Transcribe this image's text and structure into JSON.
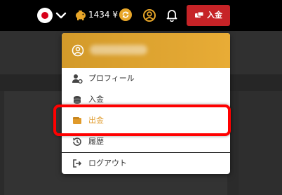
{
  "header": {
    "language_flag": "japan-flag",
    "balance": "1434 ¥",
    "deposit_label": "入金"
  },
  "account_menu": {
    "username": "",
    "items": [
      {
        "label": "プロフィール",
        "icon": "user-settings-icon"
      },
      {
        "label": "入金",
        "icon": "coins-icon"
      },
      {
        "label": "出金",
        "icon": "wallet-icon",
        "active": true
      },
      {
        "label": "履歴",
        "icon": "history-icon"
      },
      {
        "label": "ログアウト",
        "icon": "logout-icon"
      }
    ]
  },
  "colors": {
    "accent": "#e8ac36",
    "deposit_button": "#c62327",
    "highlight_box": "#ff0000"
  }
}
